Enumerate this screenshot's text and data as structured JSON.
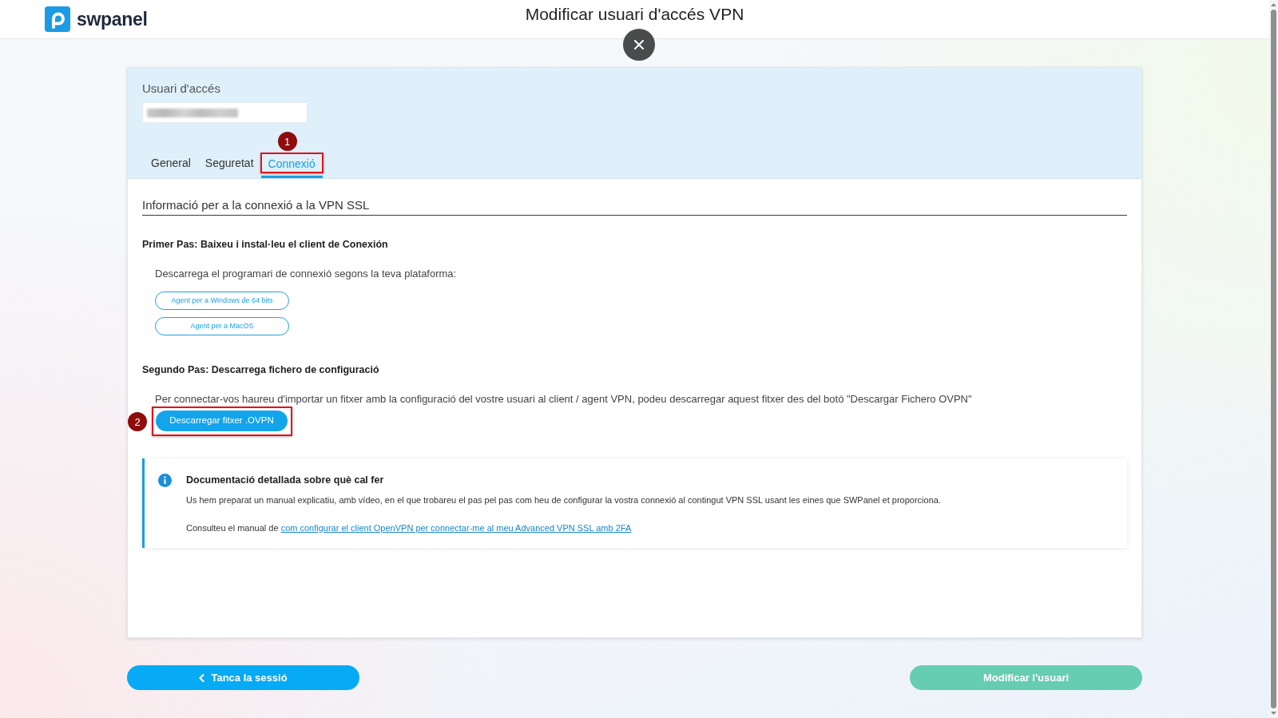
{
  "header": {
    "logo_text": "swpanel",
    "title": "Modificar usuari d'accés VPN"
  },
  "user_panel": {
    "label": "Usuari d'accés",
    "value_redacted": true,
    "tabs": [
      {
        "label": "General",
        "selected": false
      },
      {
        "label": "Seguretat",
        "selected": false
      },
      {
        "label": "Connexió",
        "selected": true,
        "callout": "1"
      }
    ]
  },
  "connection_section": {
    "heading": "Informació per a la connexió a la VPN SSL",
    "steps": [
      {
        "title": "Primer Pas: Baixeu i instal·leu el client de Conexión",
        "text": "Descarrega el programari de connexió segons la teva plataforma:",
        "buttons": [
          {
            "label": "Agent per a Windows de 64 bits",
            "kind": "outline"
          },
          {
            "label": "Agent per a MacOS",
            "kind": "outline"
          }
        ]
      },
      {
        "title": "Segundo Pas: Descarrega fichero de configuració",
        "text": "Per connectar-vos haureu d'importar un fitxer amb la configuració del vostre usuari al client / agent VPN, podeu descarregar aquest fitxer des del botó \"Descargar Fichero OVPN\"",
        "buttons": [
          {
            "label": "Descarregar fitxer .OVPN",
            "kind": "filled",
            "callout": "2"
          }
        ]
      }
    ],
    "info_box": {
      "title": "Documentació detallada sobre què cal fer",
      "text": "Us hem preparat un manual explicatiu, amb vídeo, en el que trobareu el pas pel pas com heu de configurar la vostra connexió al contingut VPN SSL usant les eines que SWPanel et proporciona.",
      "reference_text": "Consulteu el manual de",
      "link": "com configurar el client OpenVPN per connectar-me al meu Advanced VPN SSL amb 2FA"
    }
  },
  "footer_buttons": [
    {
      "label": "Tanca la sessió",
      "kind": "back"
    },
    {
      "label": "Modificar l'usuari",
      "kind": "submit"
    }
  ]
}
